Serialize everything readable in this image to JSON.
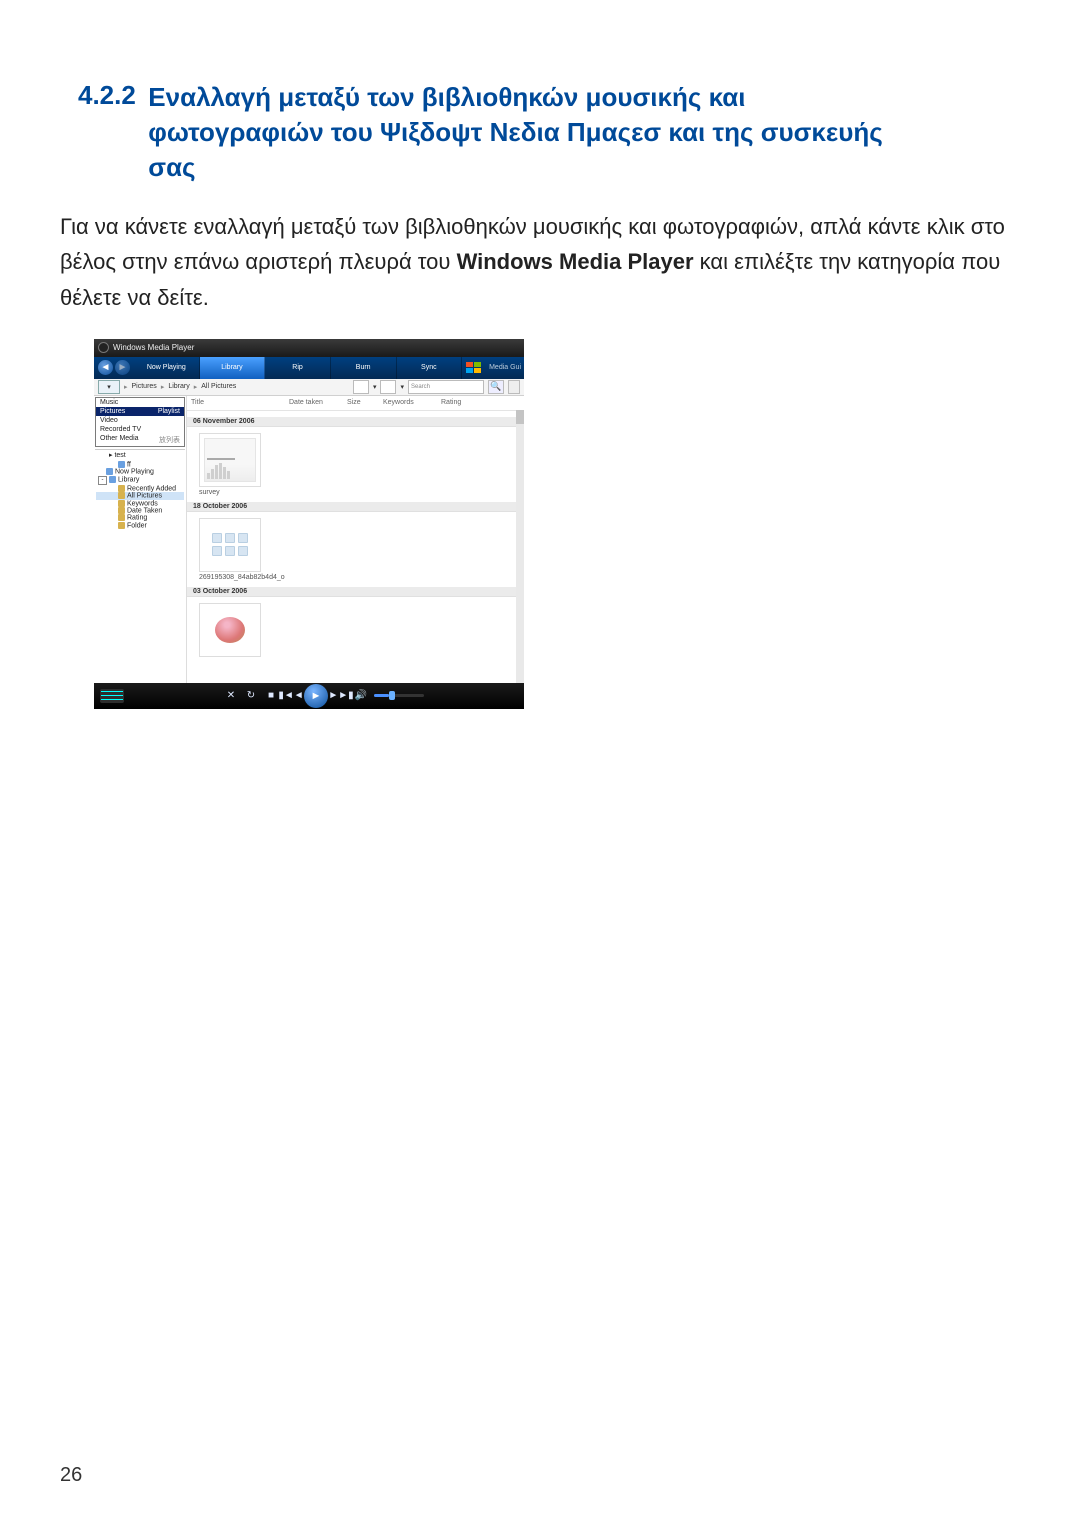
{
  "section_number": "4.2.2",
  "section_title": "Εναλλαγή μεταξύ των βιβλιοθηκών μουσικής και φωτογραφιών του Ψιξδοψτ Νεδια Πμαςεσ και της συσκευής σας",
  "body_pre": "Για να κάνετε εναλλαγή μεταξύ των βιβλιοθηκών μουσικής και φωτογραφιών, απλά κάντε κλικ στο βέλος στην επάνω αριστερή πλευρά του ",
  "body_bold": "Windows Media Player",
  "body_post": " και επιλέξτε την κατηγορία που θέλετε να δείτε.",
  "page_number": "26",
  "wmp": {
    "window_title": "Windows Media Player",
    "tabs": [
      "Now Playing",
      "Library",
      "Rip",
      "Burn",
      "Sync"
    ],
    "active_tab_index": 1,
    "media_guide": "Media Gui",
    "breadcrumbs": [
      "Pictures",
      "Library",
      "All Pictures"
    ],
    "search_placeholder": "Search",
    "category_dropdown": {
      "items": [
        "Music",
        "Pictures",
        "Video",
        "Recorded TV",
        "Other Media"
      ],
      "selected_index": 1,
      "right_labels": {
        "Pictures": "Playlist",
        "Other Media": "放列表"
      }
    },
    "tree": [
      {
        "label": "ff",
        "lv": 2,
        "ico": "blue"
      },
      {
        "label": "Now Playing",
        "lv": 1,
        "ico": "blue"
      },
      {
        "label": "Library",
        "lv": 0,
        "box": "-",
        "ico": "blue"
      },
      {
        "label": "Recently Added",
        "lv": 2,
        "ico": "fold"
      },
      {
        "label": "All Pictures",
        "lv": 2,
        "ico": "fold",
        "sel": true
      },
      {
        "label": "Keywords",
        "lv": 2,
        "ico": "fold"
      },
      {
        "label": "Date Taken",
        "lv": 2,
        "ico": "fold"
      },
      {
        "label": "Rating",
        "lv": 2,
        "ico": "fold"
      },
      {
        "label": "Folder",
        "lv": 2,
        "ico": "fold"
      }
    ],
    "columns": [
      "Title",
      "Date taken",
      "Size",
      "Keywords",
      "Rating"
    ],
    "groups": [
      {
        "heading": "06 November 2006",
        "thumb": "doc",
        "caption": "survey"
      },
      {
        "heading": "18 October 2006",
        "thumb": "icons",
        "caption": "269195308_84ab82b4d4_o"
      },
      {
        "heading": "03 October 2006",
        "thumb": "swirl",
        "caption": ""
      }
    ]
  }
}
